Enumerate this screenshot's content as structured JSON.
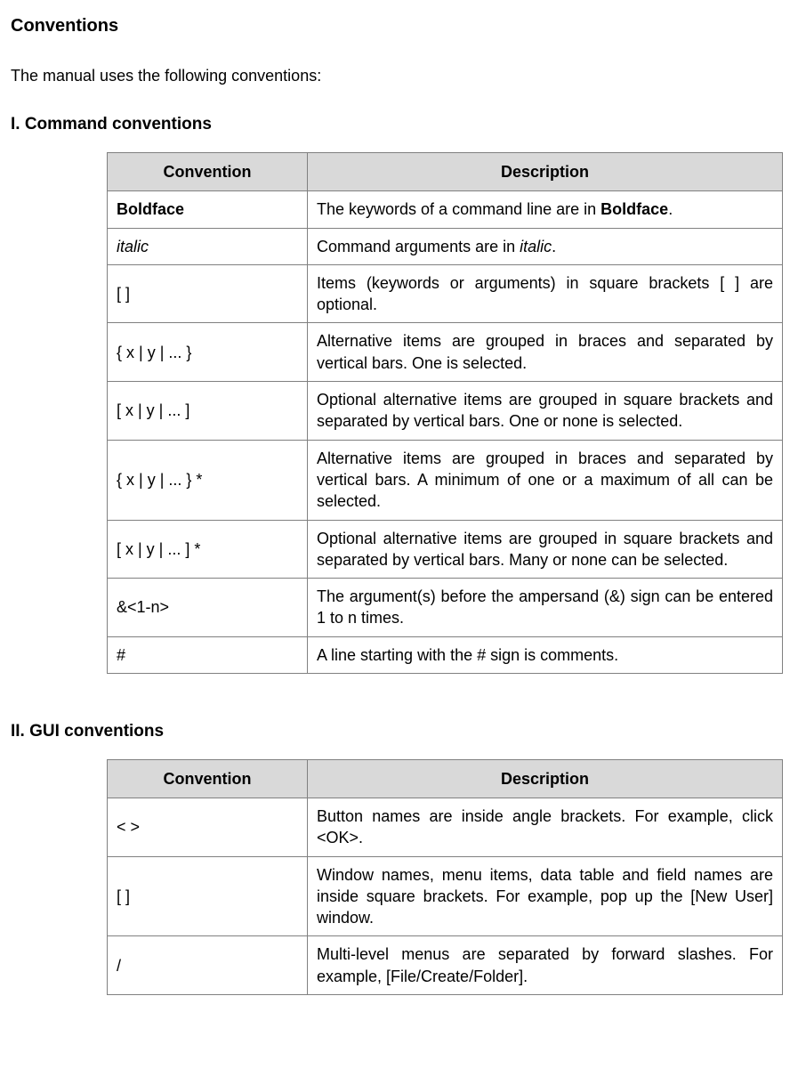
{
  "page_title": "Conventions",
  "intro": "The manual uses the following conventions:",
  "section1": {
    "title": "I. Command conventions",
    "headers": {
      "col1": "Convention",
      "col2": "Description"
    },
    "rows": [
      {
        "conv": {
          "text": "Boldface",
          "style": "bf"
        },
        "desc": {
          "segments": [
            {
              "t": "The keywords of a command line are in "
            },
            {
              "t": "Boldface",
              "style": "bf"
            },
            {
              "t": "."
            }
          ]
        }
      },
      {
        "conv": {
          "text": "italic",
          "style": "it"
        },
        "desc": {
          "segments": [
            {
              "t": "Command arguments are in "
            },
            {
              "t": "italic",
              "style": "it"
            },
            {
              "t": "."
            }
          ]
        }
      },
      {
        "conv": {
          "text": "[ ]"
        },
        "desc": {
          "segments": [
            {
              "t": "Items (keywords or arguments) in square brackets [ ] are optional."
            }
          ]
        }
      },
      {
        "conv": {
          "text": "{ x | y | ... }"
        },
        "desc": {
          "segments": [
            {
              "t": "Alternative items are grouped in braces and separated by vertical bars. One is selected."
            }
          ]
        }
      },
      {
        "conv": {
          "text": "[ x | y | ... ]"
        },
        "desc": {
          "segments": [
            {
              "t": "Optional alternative items are grouped in square brackets and separated by vertical bars. One or none is selected."
            }
          ]
        }
      },
      {
        "conv": {
          "text": "{ x | y | ... } *"
        },
        "desc": {
          "segments": [
            {
              "t": "Alternative items are grouped in braces and separated by vertical bars. A minimum of one or a maximum of all can be selected."
            }
          ]
        }
      },
      {
        "conv": {
          "text": "[ x | y | ... ] *"
        },
        "desc": {
          "segments": [
            {
              "t": "Optional alternative items are grouped in square brackets and separated by vertical bars. Many or none can be selected."
            }
          ]
        }
      },
      {
        "conv": {
          "text": "&<1-n>"
        },
        "desc": {
          "segments": [
            {
              "t": "The argument(s) before the ampersand (&) sign can be entered 1 to n times."
            }
          ]
        }
      },
      {
        "conv": {
          "text": "#"
        },
        "desc": {
          "segments": [
            {
              "t": "A line starting with the # sign is comments."
            }
          ]
        }
      }
    ]
  },
  "section2": {
    "title": "II. GUI conventions",
    "headers": {
      "col1": "Convention",
      "col2": "Description"
    },
    "rows": [
      {
        "conv": {
          "text": "< >"
        },
        "desc": {
          "segments": [
            {
              "t": "Button names are inside angle brackets. For example, click <OK>."
            }
          ]
        }
      },
      {
        "conv": {
          "text": "[ ]"
        },
        "desc": {
          "segments": [
            {
              "t": "Window names, menu items, data table and field names are inside square brackets. For example, pop up the [New User] window."
            }
          ]
        }
      },
      {
        "conv": {
          "text": "/"
        },
        "desc": {
          "segments": [
            {
              "t": "Multi-level menus are separated by forward slashes. For example, [File/Create/Folder]."
            }
          ]
        }
      }
    ]
  }
}
